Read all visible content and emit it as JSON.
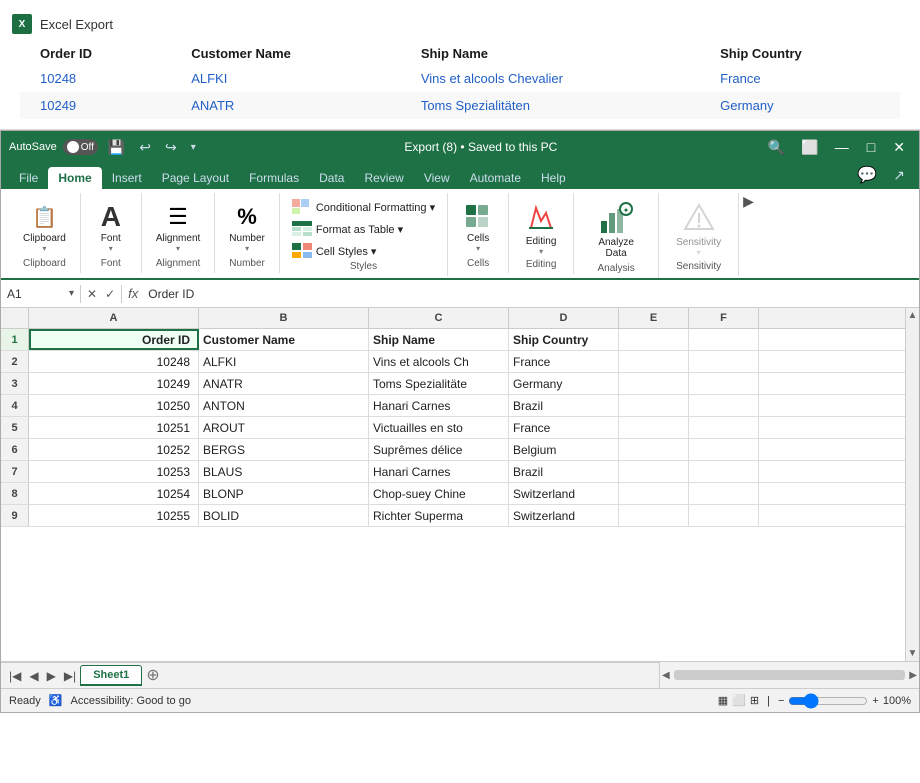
{
  "window_title": "Excel Export",
  "preview": {
    "title": "Excel Export",
    "columns": [
      "Order ID",
      "Customer Name",
      "Ship Name",
      "Ship Country"
    ],
    "rows": [
      {
        "order_id": "10248",
        "customer": "ALFKI",
        "ship_name": "Vins et alcools Chevalier",
        "country": "France"
      },
      {
        "order_id": "10249",
        "customer": "ANATR",
        "ship_name": "Toms Spezialitäten",
        "country": "Germany"
      }
    ]
  },
  "titlebar": {
    "autosave": "AutoSave",
    "off_label": "Off",
    "filename": "Export (8) • Saved to this PC",
    "minimize": "—",
    "maximize": "□",
    "close": "✕"
  },
  "ribbon_tabs": [
    "File",
    "Home",
    "Insert",
    "Page Layout",
    "Formulas",
    "Data",
    "Review",
    "View",
    "Automate",
    "Help"
  ],
  "active_tab": "Home",
  "ribbon_groups": {
    "clipboard": {
      "label": "Clipboard",
      "icon": "📋"
    },
    "font": {
      "label": "Font",
      "icon": "A"
    },
    "alignment": {
      "label": "Alignment",
      "icon": "≡"
    },
    "number": {
      "label": "Number",
      "icon": "%"
    },
    "styles": {
      "label": "Styles",
      "items": [
        {
          "label": "Conditional Formatting ▾"
        },
        {
          "label": "Format as Table ▾"
        },
        {
          "label": "Cell Styles ▾"
        }
      ]
    },
    "cells": {
      "label": "Cells",
      "icon": "🗂"
    },
    "editing": {
      "label": "Editing"
    },
    "analysis": {
      "label": "Analysis",
      "btn_label": "Analyze Data"
    },
    "sensitivity": {
      "label": "Sensitivity",
      "btn_label": "Sensitivity"
    }
  },
  "formula_bar": {
    "name_box": "A1",
    "formula": "Order ID"
  },
  "spreadsheet": {
    "col_headers": [
      "A",
      "B",
      "C",
      "D",
      "E",
      "F"
    ],
    "rows": [
      {
        "num": "1",
        "a": "Order ID",
        "b": "Customer Name",
        "c": "Ship Name",
        "d": "Ship Country",
        "e": "",
        "f": "",
        "is_header": true
      },
      {
        "num": "2",
        "a": "10248",
        "b": "ALFKI",
        "c": "Vins et alcools Ch",
        "d": "France",
        "e": "",
        "f": "",
        "is_num": true
      },
      {
        "num": "3",
        "a": "10249",
        "b": "ANATR",
        "c": "Toms Spezialitäte",
        "d": "Germany",
        "e": "",
        "f": "",
        "is_num": true
      },
      {
        "num": "4",
        "a": "10250",
        "b": "ANTON",
        "c": "Hanari Carnes",
        "d": "Brazil",
        "e": "",
        "f": "",
        "is_num": true
      },
      {
        "num": "5",
        "a": "10251",
        "b": "AROUT",
        "c": "Victuailles en sto",
        "d": "France",
        "e": "",
        "f": "",
        "is_num": true
      },
      {
        "num": "6",
        "a": "10252",
        "b": "BERGS",
        "c": "Suprêmes délice",
        "d": "Belgium",
        "e": "",
        "f": "",
        "is_num": true
      },
      {
        "num": "7",
        "a": "10253",
        "b": "BLAUS",
        "c": "Hanari Carnes",
        "d": "Brazil",
        "e": "",
        "f": "",
        "is_num": true
      },
      {
        "num": "8",
        "a": "10254",
        "b": "BLONP",
        "c": "Chop-suey Chine",
        "d": "Switzerland",
        "e": "",
        "f": "",
        "is_num": true
      },
      {
        "num": "9",
        "a": "10255",
        "b": "BOLID",
        "c": "Richter Superma",
        "d": "Switzerland",
        "e": "",
        "f": "",
        "is_num": true
      }
    ]
  },
  "sheet_tabs": [
    "Sheet1"
  ],
  "status_bar": {
    "ready": "Ready",
    "accessibility": "Accessibility: Good to go",
    "zoom": "100%"
  }
}
